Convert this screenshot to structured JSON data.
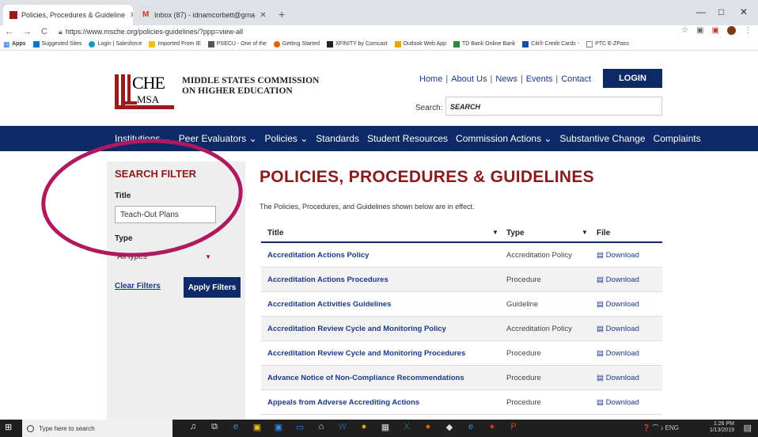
{
  "browser": {
    "tabs": [
      {
        "title": "Policies, Procedures & Guideline",
        "active": true
      },
      {
        "title": "Inbox (87) - idnamcorbett@gma",
        "active": false
      }
    ],
    "new_tab": "+",
    "url": "https://www.msche.org/policies-guidelines/?ppp=view-all",
    "window_controls": [
      "—",
      "□",
      "✕"
    ]
  },
  "bookmarks": [
    "Apps",
    "Suggested Sites",
    "Login | Salesforce",
    "Imported From IE",
    "PSECU - One of the",
    "Getting Started",
    "XFINITY by Comcast",
    "Outlook Web App",
    "TD Bank Online Bank",
    "Citi® Credit Cards -",
    "PTC E-ZPass"
  ],
  "site": {
    "logo": {
      "che": "CHE",
      "msa": "MSA"
    },
    "org_name": [
      "MIDDLE STATES COMMISSION",
      "ON HIGHER EDUCATION"
    ],
    "top_links": [
      "Home",
      "About Us",
      "News",
      "Events",
      "Contact"
    ],
    "login": "LOGIN",
    "search_label": "Search:",
    "search_value": "SEARCH"
  },
  "nav": [
    "Institutions ⌄",
    "Peer Evaluators ⌄",
    "Policies ⌄",
    "Standards",
    "Student Resources",
    "Commission Actions ⌄",
    "Substantive Change",
    "Complaints"
  ],
  "filter": {
    "heading": "SEARCH FILTER",
    "title_label": "Title",
    "title_value": "Teach-Out Plans",
    "type_label": "Type",
    "type_value": "All types",
    "clear": "Clear Filters",
    "apply": "Apply Filters"
  },
  "content": {
    "heading": "POLICIES, PROCEDURES & GUIDELINES",
    "intro": "The Policies, Procedures, and Guidelines shown below are in effect.",
    "columns": [
      "Title",
      "Type",
      "File"
    ],
    "rows": [
      {
        "title": "Accreditation Actions Policy",
        "type": "Accreditation Policy",
        "file": "Download"
      },
      {
        "title": "Accreditation Actions Procedures",
        "type": "Procedure",
        "file": "Download"
      },
      {
        "title": "Accreditation Activities Guidelines",
        "type": "Guideline",
        "file": "Download"
      },
      {
        "title": "Accreditation Review Cycle and Monitoring Policy",
        "type": "Accreditation Policy",
        "file": "Download"
      },
      {
        "title": "Accreditation Review Cycle and Monitoring Procedures",
        "type": "Procedure",
        "file": "Download"
      },
      {
        "title": "Advance Notice of Non-Compliance Recommendations",
        "type": "Procedure",
        "file": "Download"
      },
      {
        "title": "Appeals from Adverse Accrediting Actions",
        "type": "Procedure",
        "file": "Download"
      }
    ]
  },
  "taskbar": {
    "search_placeholder": "Type here to search",
    "lang": "ENG",
    "time": "1:26 PM",
    "date": "1/13/2019"
  },
  "colors": {
    "brand_red": "#8b1a1a",
    "navy": "#0d2a66",
    "highlight_circle": "#b0185f"
  }
}
